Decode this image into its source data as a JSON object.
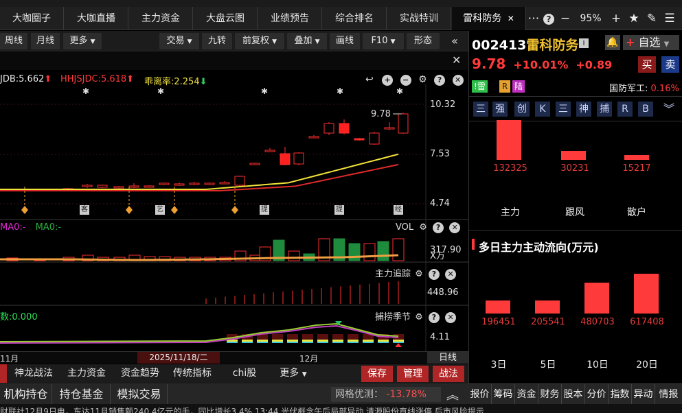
{
  "tabs": [
    "大咖圈子",
    "大咖直播",
    "主力资金",
    "大盘云图",
    "业绩预告",
    "综合排名",
    "实战特训",
    "雷科防务"
  ],
  "window": {
    "zoom": "95%"
  },
  "toolbar": {
    "left": [
      "周线",
      "月线",
      "更多"
    ],
    "right": [
      "交易",
      "九转",
      "前复权",
      "叠加",
      "画线",
      "F10",
      "形态"
    ]
  },
  "main_panel": {
    "ind1_label": "JDB:5.662",
    "ind2_label": "HHJSJDC:5.618",
    "ind3_label": "乖离率:2.254",
    "price_high_tag": "9.78",
    "axis": [
      "10.32",
      "7.53",
      "4.74"
    ],
    "markers": [
      "客",
      "艺",
      "提",
      "提",
      "经"
    ]
  },
  "vol_panel": {
    "ma1": "MA0:-",
    "ma2": "MA0:-",
    "title": "VOL",
    "axis_val": "317.90",
    "axis_unit": "X万"
  },
  "track_panel": {
    "title": "主力追踪",
    "axis_val": "448.96"
  },
  "season_panel": {
    "label": "数:0.000",
    "title": "捕捞季节",
    "axis_val": "4.11"
  },
  "date_bar": {
    "month1": "11月",
    "cursor_date": "2025/11/18/二",
    "month2": "12月",
    "period": "日线"
  },
  "bottom_tabs": [
    "神龙战法",
    "主力资金",
    "资金趋势",
    "传统指标",
    "chi股",
    "更多"
  ],
  "bottom_buttons": [
    "保存",
    "管理",
    "战法"
  ],
  "bottom2": {
    "tabs": [
      "机构持仓",
      "持仓基金",
      "模拟交易"
    ],
    "grid_label": "网格优测：",
    "grid_value": "-13.78%",
    "right_tabs": [
      "报价",
      "筹码",
      "资金",
      "财务",
      "股本",
      "分价",
      "指数",
      "异动",
      "情报"
    ]
  },
  "ticker": "财联社12月9日电，东达11月销售额240.4亿元的手，同比增长3.4%     13:44 光伏概念午后局部异动 清源股份直线涨停     后市风险提示",
  "stock": {
    "code": "002413",
    "name": "雷科防务",
    "price": "9.78",
    "pct": "+10.01%",
    "chg": "+0.89",
    "buy": "买",
    "sell": "卖",
    "fav": "自选",
    "tags": [
      "雷",
      "R",
      "陆"
    ],
    "sector": "国防军工:",
    "sector_pct": "0.16%",
    "nav": [
      "三",
      "强",
      "创",
      "K",
      "三",
      "神",
      "捕",
      "R",
      "B"
    ]
  },
  "flow": {
    "values": [
      "132325",
      "30231",
      "15217"
    ],
    "labels": [
      "主力",
      "跟风",
      "散户"
    ],
    "bar_fraction": [
      1.0,
      0.23,
      0.12
    ]
  },
  "multi_flow": {
    "title": "多日主力主动流向(万元)",
    "values": [
      "196451",
      "205541",
      "480703",
      "617408"
    ],
    "labels": [
      "3日",
      "5日",
      "10日",
      "20日"
    ],
    "bar_fraction": [
      0.32,
      0.33,
      0.78,
      1.0
    ]
  }
}
